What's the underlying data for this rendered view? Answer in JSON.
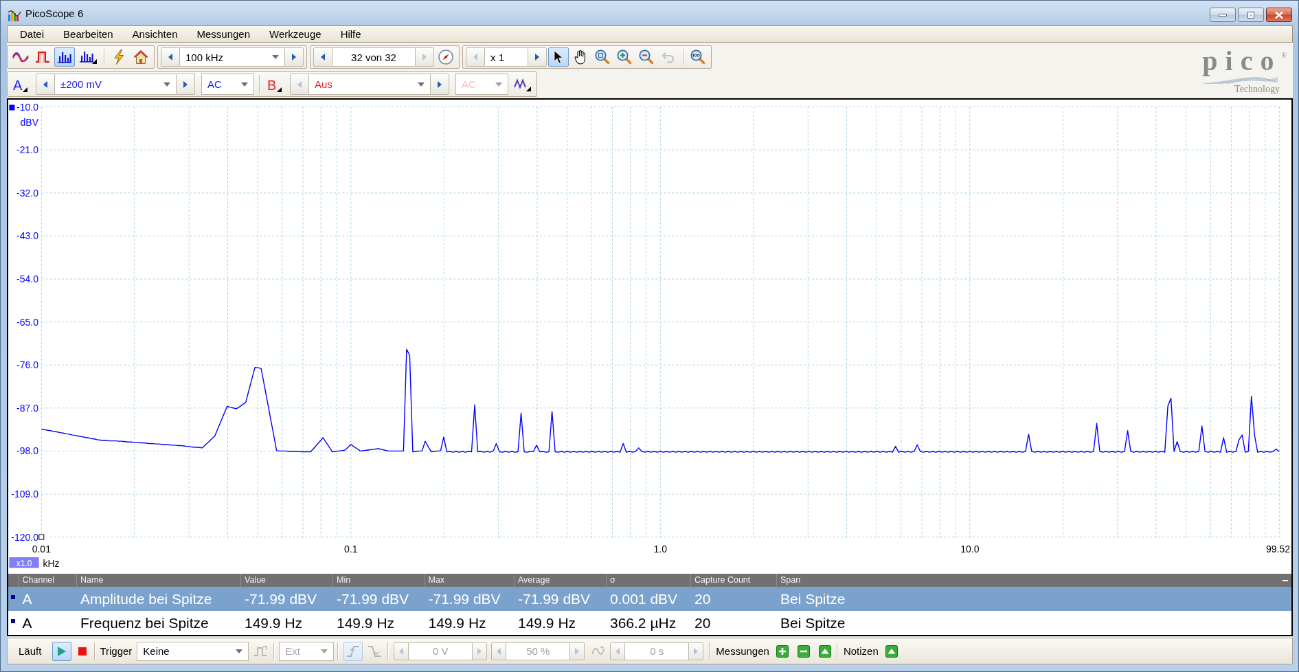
{
  "window": {
    "title": "PicoScope 6"
  },
  "menu": [
    "Datei",
    "Bearbeiten",
    "Ansichten",
    "Messungen",
    "Werkzeuge",
    "Hilfe"
  ],
  "toolbar": {
    "view_modes": [
      {
        "kind": "scope",
        "selected": false
      },
      {
        "kind": "persistence",
        "selected": false
      },
      {
        "kind": "spectrum",
        "selected": true
      },
      {
        "kind": "spectrum_options",
        "selected": false
      }
    ],
    "timebase": {
      "value": "100 kHz",
      "prev_disabled": false,
      "next_disabled": false
    },
    "buffer": {
      "value": "32 von 32",
      "prev_disabled": false,
      "next_disabled": true
    },
    "zoom": {
      "value": "x 1",
      "prev_disabled": true,
      "next_disabled": false
    },
    "cursor_tools": [
      {
        "kind": "pointer",
        "selected": true,
        "disabled": false
      },
      {
        "kind": "hand",
        "selected": false,
        "disabled": false
      },
      {
        "kind": "zoom_fit",
        "selected": false,
        "disabled": false
      },
      {
        "kind": "zoom_in",
        "selected": false,
        "disabled": false
      },
      {
        "kind": "zoom_out",
        "selected": false,
        "disabled": false
      },
      {
        "kind": "undo",
        "selected": false,
        "disabled": true
      },
      {
        "kind": "zoom_100",
        "selected": false,
        "disabled": false
      }
    ]
  },
  "channels": [
    {
      "label": "A",
      "color": "#2020ee",
      "range": {
        "value": "±200 mV",
        "prev_disabled": false,
        "next_disabled": false
      },
      "coupling": {
        "value": "AC",
        "disabled": false
      }
    },
    {
      "label": "B",
      "color": "#ee2020",
      "range": {
        "value": "Aus",
        "prev_disabled": true,
        "next_disabled": false
      },
      "coupling": {
        "value": "AC",
        "disabled": true
      }
    }
  ],
  "logo": {
    "wordmark": "pico$^{®}$",
    "tagline": "Technology"
  },
  "chart": {
    "x_scale_badge": "x1.0",
    "chart_data": {
      "type": "line",
      "xlabel": "kHz",
      "ylabel": "dBV",
      "grid": true,
      "ylim": [
        -120,
        -10
      ],
      "yticks": [
        {
          "value": -10,
          "label": "-10.0"
        },
        {
          "value": -21,
          "label": "-21.0"
        },
        {
          "value": -32,
          "label": "-32.0"
        },
        {
          "value": -43,
          "label": "-43.0"
        },
        {
          "value": -54,
          "label": "-54.0"
        },
        {
          "value": -65,
          "label": "-65.0"
        },
        {
          "value": -76,
          "label": "-76.0"
        },
        {
          "value": -87,
          "label": "-87.0"
        },
        {
          "value": -98,
          "label": "-98.0"
        },
        {
          "value": -109,
          "label": "-109.0"
        },
        {
          "value": -120,
          "label": "-120.0"
        }
      ],
      "categories": [
        "0.01",
        null,
        null,
        null,
        null,
        null,
        null,
        null,
        null,
        null,
        null,
        null,
        null,
        null,
        null,
        null,
        null,
        null,
        null,
        null,
        null,
        null,
        null,
        null,
        null,
        null,
        null,
        null,
        null,
        null,
        null,
        null,
        null,
        null,
        null,
        null,
        null,
        null,
        null,
        null,
        null,
        null,
        null,
        null,
        null,
        null,
        null,
        null,
        null,
        null,
        null,
        null,
        null,
        null,
        null,
        null,
        null,
        null,
        null,
        null,
        null,
        null,
        null,
        null,
        null,
        null,
        null,
        null,
        null,
        null,
        null,
        null,
        null,
        null,
        null,
        null,
        null,
        null,
        null,
        null,
        null,
        null,
        null,
        null,
        null,
        null,
        null,
        null,
        null,
        null,
        null,
        null,
        null,
        null,
        null,
        null,
        null,
        null,
        null,
        null,
        "0.1",
        null,
        null,
        null,
        null,
        null,
        null,
        null,
        null,
        null,
        null,
        null,
        null,
        null,
        null,
        null,
        null,
        null,
        null,
        null,
        null,
        null,
        null,
        null,
        null,
        null,
        null,
        null,
        null,
        null,
        null,
        null,
        null,
        null,
        null,
        null,
        null,
        null,
        null,
        null,
        null,
        null,
        null,
        null,
        null,
        null,
        null,
        null,
        null,
        null,
        null,
        null,
        null,
        null,
        null,
        null,
        null,
        null,
        null,
        null,
        null,
        null,
        null,
        null,
        null,
        null,
        null,
        null,
        null,
        null,
        null,
        null,
        null,
        null,
        null,
        null,
        null,
        null,
        null,
        null,
        null,
        null,
        null,
        null,
        null,
        null,
        null,
        null,
        null,
        null,
        null,
        null,
        null,
        null,
        null,
        null,
        null,
        null,
        null,
        null,
        "1.0",
        null,
        null,
        null,
        null,
        null,
        null,
        null,
        null,
        null,
        null,
        null,
        null,
        null,
        null,
        null,
        null,
        null,
        null,
        null,
        null,
        null,
        null,
        null,
        null,
        null,
        null,
        null,
        null,
        null,
        null,
        null,
        null,
        null,
        null,
        null,
        null,
        null,
        null,
        null,
        null,
        null,
        null,
        null,
        null,
        null,
        null,
        null,
        null,
        null,
        null,
        null,
        null,
        null,
        null,
        null,
        null,
        null,
        null,
        null,
        null,
        null,
        null,
        null,
        null,
        null,
        null,
        null,
        null,
        null,
        null,
        null,
        null,
        null,
        null,
        null,
        null,
        null,
        null,
        null,
        null,
        null,
        null,
        null,
        null,
        null,
        null,
        null,
        null,
        null,
        null,
        null,
        null,
        null,
        null,
        null,
        null,
        null,
        null,
        null,
        "10.0",
        null,
        null,
        null,
        null,
        null,
        null,
        null,
        null,
        null,
        null,
        null,
        null,
        null,
        null,
        null,
        null,
        null,
        null,
        null,
        null,
        null,
        null,
        null,
        null,
        null,
        null,
        null,
        null,
        null,
        null,
        null,
        null,
        null,
        null,
        null,
        null,
        null,
        null,
        null,
        null,
        null,
        null,
        null,
        null,
        null,
        null,
        null,
        null,
        null,
        null,
        null,
        null,
        null,
        null,
        null,
        null,
        null,
        null,
        null,
        null,
        null,
        null,
        null,
        null,
        null,
        null,
        null,
        null,
        null,
        null,
        null,
        null,
        null,
        null,
        null,
        null,
        null,
        null,
        null,
        null,
        null,
        null,
        null,
        null,
        null,
        null,
        null,
        null,
        null,
        null,
        null,
        null,
        null,
        null,
        null,
        null,
        null,
        null,
        null,
        "99.52"
      ],
      "series": [
        {
          "color": "#0000ff",
          "values": [
            -92.4,
            -92.5,
            -92.7,
            -92.8,
            -93.0,
            -93.1,
            -93.3,
            -93.4,
            -93.6,
            -93.7,
            -93.9,
            -94.0,
            -94.2,
            -94.3,
            -94.5,
            -94.6,
            -94.8,
            -94.9,
            -95.1,
            -95.2,
            -95.3,
            -95.3,
            -95.4,
            -95.4,
            -95.4,
            -95.5,
            -95.5,
            -95.6,
            -95.7,
            -95.7,
            -95.8,
            -95.8,
            -95.9,
            -95.9,
            -96.0,
            -96.1,
            -96.1,
            -96.2,
            -96.2,
            -96.3,
            -96.4,
            -96.4,
            -96.5,
            -96.5,
            -96.6,
            -96.6,
            -96.7,
            -96.8,
            -96.9,
            -97.0,
            -97.0,
            -97.1,
            -97.2,
            -96.4,
            -95.7,
            -94.9,
            -94.2,
            -92.3,
            -90.4,
            -88.5,
            -86.6,
            -86.8,
            -87.0,
            -87.2,
            -86.7,
            -86.1,
            -85.6,
            -82.6,
            -79.6,
            -76.6,
            -76.7,
            -76.9,
            -81.1,
            -85.3,
            -89.5,
            -93.7,
            -97.9,
            -98.0,
            -98.0,
            -98.0,
            -98.1,
            -98.1,
            -98.1,
            -98.1,
            -98.2,
            -98.2,
            -98.2,
            -98.2,
            -97.3,
            -96.4,
            -95.5,
            -94.6,
            -95.8,
            -97.0,
            -98.2,
            -98.1,
            -98.0,
            -97.9,
            -97.8,
            -97.1,
            -96.3,
            -96.9,
            -97.4,
            -98.0,
            -97.9,
            -97.8,
            -97.7,
            -97.6,
            -97.5,
            -97.4,
            -97.6,
            -97.8,
            -98.0,
            -98.0,
            -98.0,
            -98.0,
            -98.0,
            -98.0,
            -72.0,
            -73.5,
            -98.2,
            -98.1,
            -98.0,
            -98.0,
            -95.5,
            -96.9,
            -98.2,
            -98.1,
            -98.0,
            -97.9,
            -94.4,
            -98.2,
            -98.1,
            -98.3,
            -98.1,
            -98.3,
            -98.1,
            -98.3,
            -98.1,
            -98.2,
            -86.2,
            -98.2,
            -98.1,
            -98.3,
            -98.1,
            -98.3,
            -98.0,
            -96.1,
            -98.2,
            -98.3,
            -98.1,
            -98.3,
            -98.1,
            -98.3,
            -98.2,
            -88.3,
            -98.2,
            -98.3,
            -98.1,
            -98.1,
            -96.5,
            -98.2,
            -98.1,
            -98.3,
            -98.2,
            -87.9,
            -98.2,
            -98.3,
            -98.1,
            -98.3,
            -98.1,
            -98.3,
            -98.1,
            -98.3,
            -98.1,
            -98.3,
            -98.1,
            -98.3,
            -98.1,
            -98.3,
            -98.1,
            -98.3,
            -98.1,
            -98.3,
            -98.1,
            -98.3,
            -98.1,
            -98.3,
            -96.1,
            -98.3,
            -98.1,
            -98.3,
            -98.1,
            -97.2,
            -98.1,
            -98.3,
            -98.1,
            -98.3,
            -98.1,
            -98.3,
            -98.1,
            -98.3,
            -98.1,
            -98.3,
            -98.1,
            -98.3,
            -98.1,
            -98.3,
            -98.1,
            -98.3,
            -98.1,
            -98.3,
            -98.1,
            -98.3,
            -98.1,
            -98.3,
            -98.1,
            -98.3,
            -98.1,
            -98.3,
            -98.1,
            -98.3,
            -98.1,
            -98.3,
            -98.1,
            -98.3,
            -98.1,
            -98.3,
            -98.1,
            -98.3,
            -98.1,
            -98.3,
            -98.1,
            -98.3,
            -98.1,
            -98.3,
            -98.1,
            -98.3,
            -98.1,
            -98.3,
            -98.1,
            -98.3,
            -98.1,
            -98.3,
            -98.1,
            -98.3,
            -98.1,
            -98.3,
            -98.1,
            -98.3,
            -98.1,
            -98.3,
            -98.1,
            -98.3,
            -98.1,
            -98.3,
            -98.1,
            -98.3,
            -98.1,
            -98.3,
            -98.1,
            -98.3,
            -98.1,
            -98.3,
            -98.1,
            -98.3,
            -98.1,
            -98.3,
            -98.1,
            -98.3,
            -98.1,
            -98.3,
            -98.1,
            -98.3,
            -98.1,
            -98.3,
            -96.8,
            -98.3,
            -98.1,
            -98.3,
            -98.1,
            -98.3,
            -98.1,
            -96.4,
            -98.1,
            -98.3,
            -98.1,
            -98.3,
            -98.1,
            -98.3,
            -98.1,
            -98.3,
            -98.1,
            -98.3,
            -98.1,
            -98.3,
            -98.1,
            -98.3,
            -98.1,
            -98.3,
            -98.1,
            -98.3,
            -98.1,
            -98.3,
            -98.1,
            -98.3,
            -98.1,
            -98.3,
            -98.1,
            -98.3,
            -98.1,
            -98.3,
            -98.1,
            -98.3,
            -98.1,
            -98.3,
            -98.1,
            -98.3,
            -98.1,
            -93.7,
            -98.1,
            -98.3,
            -98.1,
            -98.3,
            -98.1,
            -98.3,
            -98.1,
            -98.3,
            -98.1,
            -98.3,
            -98.1,
            -98.3,
            -98.1,
            -98.3,
            -98.1,
            -98.3,
            -98.1,
            -98.3,
            -98.1,
            -98.3,
            -98.1,
            -90.9,
            -98.1,
            -98.3,
            -98.1,
            -98.3,
            -98.1,
            -98.3,
            -98.1,
            -98.3,
            -98.1,
            -92.8,
            -98.1,
            -98.3,
            -98.1,
            -98.3,
            -98.1,
            -98.3,
            -98.1,
            -98.3,
            -98.1,
            -98.3,
            -98.1,
            -98.3,
            -86.5,
            -84.5,
            -98.1,
            -95.6,
            -98.1,
            -98.3,
            -98.1,
            -98.3,
            -98.1,
            -98.3,
            -98.1,
            -91.6,
            -98.1,
            -98.3,
            -98.1,
            -98.3,
            -98.1,
            -98.3,
            -94.6,
            -98.3,
            -98.1,
            -98.3,
            -98.1,
            -95.1,
            -93.9,
            -98.3,
            -98.1,
            -84.0,
            -93.9,
            -98.3,
            -98.1,
            -98.3,
            -98.1,
            -98.3,
            -98.1,
            -97.5,
            -98.2
          ]
        }
      ]
    }
  },
  "measurements": {
    "columns": [
      "Channel",
      "Name",
      "Value",
      "Min",
      "Max",
      "Average",
      "σ",
      "Capture Count",
      "Span"
    ],
    "rows": [
      {
        "selected": true,
        "cells": [
          "A",
          "Amplitude bei Spitze",
          "-71.99 dBV",
          "-71.99 dBV",
          "-71.99 dBV",
          "-71.99 dBV",
          "0.001 dBV",
          "20",
          "Bei Spitze"
        ]
      },
      {
        "selected": false,
        "cells": [
          "A",
          "Frequenz bei Spitze",
          "149.9 Hz",
          "149.9 Hz",
          "149.9 Hz",
          "149.9 Hz",
          "366.2 µHz",
          "20",
          "Bei Spitze"
        ]
      }
    ]
  },
  "status_bar": {
    "run": {
      "label": "Läuft",
      "buttons": [
        {
          "kind": "play",
          "selected": true
        },
        {
          "kind": "stop",
          "selected": false
        }
      ]
    },
    "trigger": {
      "label": "Trigger",
      "controls": [
        {
          "kind": "dropdown",
          "value": "Keine",
          "disabled": false
        },
        {
          "kind": "trigger_type",
          "selected": false,
          "disabled": true
        },
        {
          "kind": "dropdown",
          "value": "Ext",
          "disabled": true
        },
        {
          "kind": "edge_rising",
          "selected": true,
          "disabled": true
        },
        {
          "kind": "edge_falling",
          "selected": false,
          "disabled": true
        },
        {
          "kind": "spinner",
          "value": "0 V",
          "disabled": true
        },
        {
          "kind": "spinner",
          "value": "50 %",
          "disabled": true
        },
        {
          "kind": "pre_trigger",
          "selected": false,
          "disabled": true
        },
        {
          "kind": "spinner",
          "value": "0 s",
          "disabled": true
        }
      ]
    },
    "measurements_label": "Messungen",
    "notes_label": "Notizen"
  }
}
